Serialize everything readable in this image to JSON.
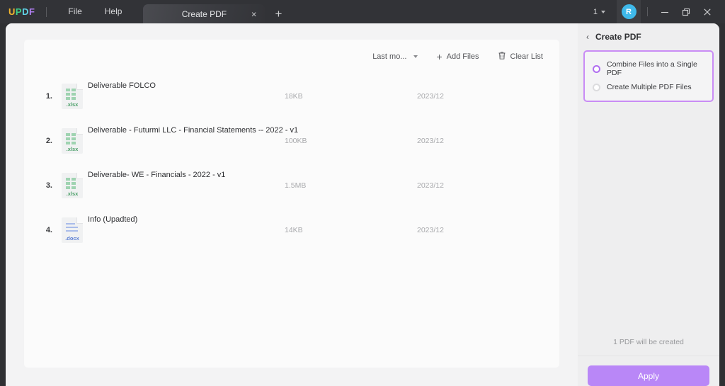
{
  "titlebar": {
    "logo": {
      "u": "U",
      "p": "P",
      "d": "D",
      "f": "F"
    },
    "menus": [
      {
        "label": "File",
        "name": "menu-file"
      },
      {
        "label": "Help",
        "name": "menu-help"
      }
    ],
    "tab": {
      "label": "Create PDF",
      "close": "×"
    },
    "new_tab": "+",
    "page_count": "1",
    "avatar_initial": "R",
    "window_controls": {
      "minimize": "minimize",
      "maximize": "maximize",
      "close": "close"
    }
  },
  "toolbar": {
    "sort_label": "Last mo...",
    "add_files_label": "Add Files",
    "add_files_plus": "+",
    "clear_list_label": "Clear List"
  },
  "files": [
    {
      "index": "1.",
      "name": "Deliverable FOLCO",
      "ext": ".xlsx",
      "type": "xlsx",
      "size": "18KB",
      "date": "2023/12"
    },
    {
      "index": "2.",
      "name": "Deliverable - Futurmi LLC -  Financial Statements -- 2022 - v1",
      "ext": ".xlsx",
      "type": "xlsx",
      "size": "100KB",
      "date": "2023/12"
    },
    {
      "index": "3.",
      "name": "Deliverable- WE - Financials -  2022 - v1",
      "ext": ".xlsx",
      "type": "xlsx",
      "size": "1.5MB",
      "date": "2023/12"
    },
    {
      "index": "4.",
      "name": "Info (Upadted)",
      "ext": ".docx",
      "type": "docx",
      "size": "14KB",
      "date": "2023/12"
    }
  ],
  "right_panel": {
    "back": "‹",
    "title": "Create PDF",
    "options": [
      {
        "label": "Combine Files into a Single PDF",
        "selected": true
      },
      {
        "label": "Create Multiple PDF Files",
        "selected": false
      }
    ],
    "status": "1 PDF will be created",
    "apply_label": "Apply"
  },
  "colors": {
    "accent_purple": "#b987f7",
    "option_border": "#c98cf5",
    "avatar_blue": "#3fb9ea",
    "xlsx_green": "#4da06a",
    "docx_blue": "#5b7fd4"
  }
}
